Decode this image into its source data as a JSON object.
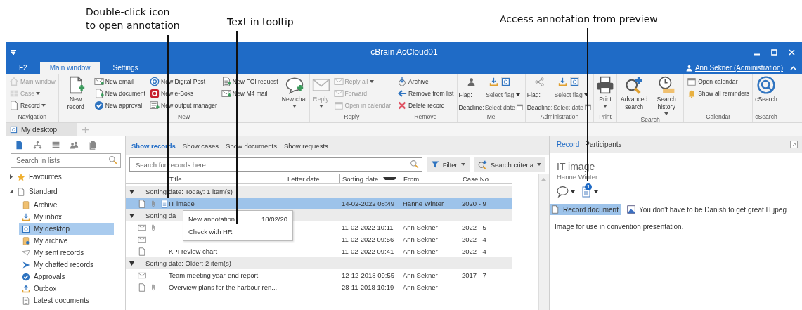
{
  "callouts": [
    {
      "lines": [
        "Double-click icon",
        "to open annotation"
      ]
    },
    {
      "lines": [
        "Text in tooltip"
      ]
    },
    {
      "lines": [
        "Access annotation from preview"
      ]
    }
  ],
  "window": {
    "title": "cBrain AcCloud01",
    "user": "Ann Sekner (Administration)"
  },
  "ribbon_tabs": [
    {
      "label": "F2",
      "selected": false
    },
    {
      "label": "Main window",
      "selected": true
    },
    {
      "label": "Settings",
      "selected": false
    }
  ],
  "ribbon_groups": [
    {
      "label": "Navigation",
      "columns": [
        {
          "kind": "list",
          "items": [
            {
              "label": "Main window",
              "disabled": true,
              "dropdown": false
            },
            {
              "label": "Case",
              "disabled": true,
              "dropdown": true
            },
            {
              "label": "Record",
              "disabled": false,
              "dropdown": true
            }
          ]
        }
      ]
    },
    {
      "label": "New",
      "columns": [
        {
          "kind": "large",
          "label": "New record",
          "disabled": false,
          "dropdown": false
        },
        {
          "kind": "list",
          "items": [
            {
              "label": "New email",
              "disabled": false,
              "dropdown": false
            },
            {
              "label": "New document",
              "disabled": false,
              "dropdown": false
            },
            {
              "label": "New approval",
              "disabled": false,
              "dropdown": false
            }
          ]
        },
        {
          "kind": "list",
          "items": [
            {
              "label": "New Digital Post",
              "disabled": false,
              "dropdown": false
            },
            {
              "label": "New e-Boks",
              "disabled": false,
              "dropdown": false
            },
            {
              "label": "New output manager",
              "disabled": false,
              "dropdown": false
            }
          ]
        },
        {
          "kind": "list",
          "items": [
            {
              "label": "New FOI request",
              "disabled": false,
              "dropdown": false
            },
            {
              "label": "New M4 mail",
              "disabled": false,
              "dropdown": false
            }
          ]
        },
        {
          "kind": "large",
          "label": "New chat",
          "disabled": false,
          "dropdown": true
        }
      ]
    },
    {
      "label": "Reply",
      "columns": [
        {
          "kind": "large",
          "label": "Reply",
          "disabled": true,
          "dropdown": true
        },
        {
          "kind": "list",
          "items": [
            {
              "label": "Reply all",
              "disabled": true,
              "dropdown": true
            },
            {
              "label": "Forward",
              "disabled": true,
              "dropdown": false
            },
            {
              "label": "Open in calendar",
              "disabled": true,
              "dropdown": false
            }
          ]
        }
      ]
    },
    {
      "label": "Remove",
      "columns": [
        {
          "kind": "list",
          "items": [
            {
              "label": "Archive",
              "disabled": false,
              "dropdown": false
            },
            {
              "label": "Remove from list",
              "disabled": false,
              "dropdown": false
            },
            {
              "label": "Delete record",
              "disabled": false,
              "dropdown": false
            }
          ]
        }
      ]
    },
    {
      "label": "Me",
      "columns": [
        {
          "kind": "flags",
          "fields": [
            {
              "kind": "flag",
              "label": "Flag:",
              "value": "Select flag"
            },
            {
              "kind": "date",
              "label": "Deadline:",
              "value": "Select date"
            }
          ]
        }
      ]
    },
    {
      "label": "Administration",
      "columns": [
        {
          "kind": "flags",
          "fields": [
            {
              "kind": "flag",
              "label": "Flag:",
              "value": "Select flag"
            },
            {
              "kind": "date",
              "label": "Deadline:",
              "value": "Select date"
            }
          ]
        }
      ]
    },
    {
      "label": "Print",
      "columns": [
        {
          "kind": "large",
          "label": "Print",
          "disabled": false,
          "dropdown": true
        }
      ]
    },
    {
      "label": "Search",
      "columns": [
        {
          "kind": "large",
          "label": "Advanced search",
          "disabled": false,
          "dropdown": false
        },
        {
          "kind": "large",
          "label": "Search history",
          "disabled": false,
          "dropdown": true
        }
      ]
    },
    {
      "label": "Calendar",
      "columns": [
        {
          "kind": "list",
          "items": [
            {
              "label": "Open calendar",
              "disabled": false,
              "dropdown": false
            },
            {
              "label": "Show all reminders",
              "disabled": false,
              "dropdown": false
            }
          ]
        }
      ]
    },
    {
      "label": "cSearch",
      "columns": [
        {
          "kind": "large",
          "label": "cSearch",
          "disabled": false,
          "dropdown": false
        }
      ]
    }
  ],
  "desktop_tabs": [
    {
      "label": "My desktop",
      "selected": true
    }
  ],
  "sidebar": {
    "search": {
      "placeholder": "Search in lists"
    },
    "tree": [
      {
        "label": "Favourites",
        "expanded": false,
        "selected": false
      },
      {
        "label": "Standard",
        "expanded": true,
        "selected": false,
        "children": [
          {
            "label": "Archive",
            "selected": false
          },
          {
            "label": "My inbox",
            "selected": false
          },
          {
            "label": "My desktop",
            "selected": true
          },
          {
            "label": "My archive",
            "selected": false
          },
          {
            "label": "My sent records",
            "selected": false
          },
          {
            "label": "My chatted records",
            "selected": false
          },
          {
            "label": "Approvals",
            "selected": false
          },
          {
            "label": "Outbox",
            "selected": false
          },
          {
            "label": "Latest documents",
            "selected": false
          }
        ]
      }
    ]
  },
  "records": {
    "views": [
      {
        "label": "Show records",
        "selected": true
      },
      {
        "label": "Show cases",
        "selected": false
      },
      {
        "label": "Show documents",
        "selected": false
      },
      {
        "label": "Show requests",
        "selected": false
      }
    ],
    "search": {
      "placeholder": "Search for records here"
    },
    "filter": "Filter",
    "search_criteria": "Search criteria",
    "columns": [
      {
        "label": "Title",
        "sorted": false
      },
      {
        "label": "Letter date",
        "sorted": false
      },
      {
        "label": "Sorting date",
        "sorted": true
      },
      {
        "label": "From",
        "sorted": false
      },
      {
        "label": "Case No",
        "sorted": false
      }
    ],
    "groups": [
      {
        "label": "Sorting date: Today: 1 item(s)",
        "expanded": true,
        "rows": [
          {
            "kind": "document",
            "attachment": true,
            "annotation": true,
            "title": "IT image",
            "sorting_date": "14-02-2022 08:49",
            "from": "Hanne Winter",
            "case_no": "2020 - 9",
            "selected": true
          }
        ]
      },
      {
        "label": "Sorting da",
        "expanded": true,
        "rows": [
          {
            "kind": "mail",
            "attachment": true,
            "annotation": false,
            "sorting_date": "11-02-2022 10:11",
            "from": "Ann Sekner",
            "case_no": "2022 - 5",
            "selected": false
          },
          {
            "kind": "mail",
            "attachment": false,
            "annotation": false,
            "sorting_date": "11-02-2022 09:56",
            "from": "Ann Sekner",
            "case_no": "2022 - 4",
            "selected": false
          },
          {
            "kind": "document",
            "attachment": false,
            "annotation": false,
            "title": "KPI review chart",
            "sorting_date": "11-02-2022 09:41",
            "from": "Ann Sekner",
            "case_no": "2022 - 4",
            "selected": false
          }
        ]
      },
      {
        "label": "Sorting date: Older: 2 item(s)",
        "expanded": true,
        "rows": [
          {
            "kind": "mail",
            "attachment": false,
            "annotation": false,
            "title": "Team meeting year-end report",
            "sorting_date": "12-12-2018 09:55",
            "from": "Ann Sekner",
            "case_no": "2017 - 7",
            "selected": false
          },
          {
            "kind": "document",
            "attachment": true,
            "annotation": false,
            "title": "Overview plans for the harbour ren...",
            "sorting_date": "28-11-2018 10:19",
            "from": "Ann Sekner",
            "selected": false
          }
        ]
      }
    ],
    "tooltip": [
      {
        "text": "New annotation",
        "date": "18/02/20"
      },
      {
        "text": "Check with HR"
      }
    ]
  },
  "preview": {
    "tabs": [
      {
        "label": "Record",
        "selected": true
      },
      {
        "label": "Participants",
        "selected": false
      }
    ],
    "title": "IT image",
    "author": "Hanne Winter",
    "annotation_count": "1",
    "documents": [
      {
        "kind": "record",
        "label": "Record document",
        "selected": true
      },
      {
        "kind": "image",
        "label": "You don't have to be Danish to get great IT.jpeg",
        "selected": false
      }
    ],
    "description": "Image for use in convention presentation."
  }
}
